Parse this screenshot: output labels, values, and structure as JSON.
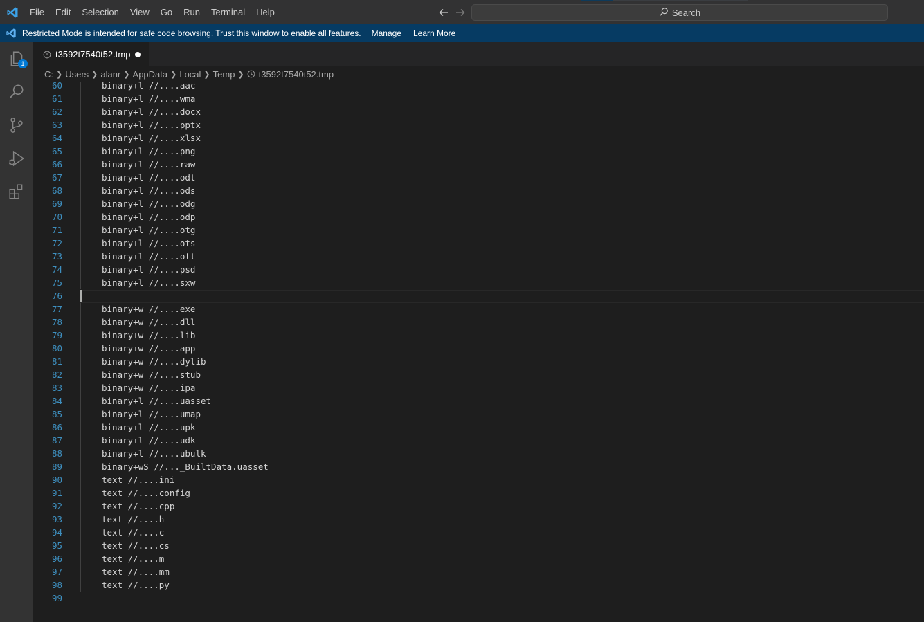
{
  "menu": {
    "items": [
      "File",
      "Edit",
      "Selection",
      "View",
      "Go",
      "Run",
      "Terminal",
      "Help"
    ]
  },
  "search": {
    "label": "Search"
  },
  "banner": {
    "message": "Restricted Mode is intended for safe code browsing. Trust this window to enable all features.",
    "manage": "Manage",
    "learn_more": "Learn More"
  },
  "activity": {
    "explorer_badge": "1"
  },
  "tab": {
    "filename": "t3592t7540t52.tmp",
    "dirty": true
  },
  "breadcrumb": [
    "C:",
    "Users",
    "alanr",
    "AppData",
    "Local",
    "Temp",
    "t3592t7540t52.tmp"
  ],
  "editor": {
    "current_line": 76,
    "lines": [
      {
        "n": "60",
        "text": "binary+l //....aac"
      },
      {
        "n": "61",
        "text": "binary+l //....wma"
      },
      {
        "n": "62",
        "text": "binary+l //....docx"
      },
      {
        "n": "63",
        "text": "binary+l //....pptx"
      },
      {
        "n": "64",
        "text": "binary+l //....xlsx"
      },
      {
        "n": "65",
        "text": "binary+l //....png"
      },
      {
        "n": "66",
        "text": "binary+l //....raw"
      },
      {
        "n": "67",
        "text": "binary+l //....odt"
      },
      {
        "n": "68",
        "text": "binary+l //....ods"
      },
      {
        "n": "69",
        "text": "binary+l //....odg"
      },
      {
        "n": "70",
        "text": "binary+l //....odp"
      },
      {
        "n": "71",
        "text": "binary+l //....otg"
      },
      {
        "n": "72",
        "text": "binary+l //....ots"
      },
      {
        "n": "73",
        "text": "binary+l //....ott"
      },
      {
        "n": "74",
        "text": "binary+l //....psd"
      },
      {
        "n": "75",
        "text": "binary+l //....sxw"
      },
      {
        "n": "76",
        "text": ""
      },
      {
        "n": "77",
        "text": "binary+w //....exe"
      },
      {
        "n": "78",
        "text": "binary+w //....dll"
      },
      {
        "n": "79",
        "text": "binary+w //....lib"
      },
      {
        "n": "80",
        "text": "binary+w //....app"
      },
      {
        "n": "81",
        "text": "binary+w //....dylib"
      },
      {
        "n": "82",
        "text": "binary+w //....stub"
      },
      {
        "n": "83",
        "text": "binary+w //....ipa"
      },
      {
        "n": "84",
        "text": "binary+l //....uasset"
      },
      {
        "n": "85",
        "text": "binary+l //....umap"
      },
      {
        "n": "86",
        "text": "binary+l //....upk"
      },
      {
        "n": "87",
        "text": "binary+l //....udk"
      },
      {
        "n": "88",
        "text": "binary+l //....ubulk"
      },
      {
        "n": "89",
        "text": "binary+wS //..._BuiltData.uasset"
      },
      {
        "n": "90",
        "text": "text //....ini"
      },
      {
        "n": "91",
        "text": "text //....config"
      },
      {
        "n": "92",
        "text": "text //....cpp"
      },
      {
        "n": "93",
        "text": "text //....h"
      },
      {
        "n": "94",
        "text": "text //....c"
      },
      {
        "n": "95",
        "text": "text //....cs"
      },
      {
        "n": "96",
        "text": "text //....m"
      },
      {
        "n": "97",
        "text": "text //....mm"
      },
      {
        "n": "98",
        "text": "text //....py"
      },
      {
        "n": "99",
        "text": ""
      }
    ]
  },
  "colors": {
    "titlebar": "#323233",
    "banner": "#063b63",
    "activitybar": "#333333",
    "editor_bg": "#1e1e1e",
    "line_number": "#3e8fbf",
    "accent": "#0078d4"
  }
}
